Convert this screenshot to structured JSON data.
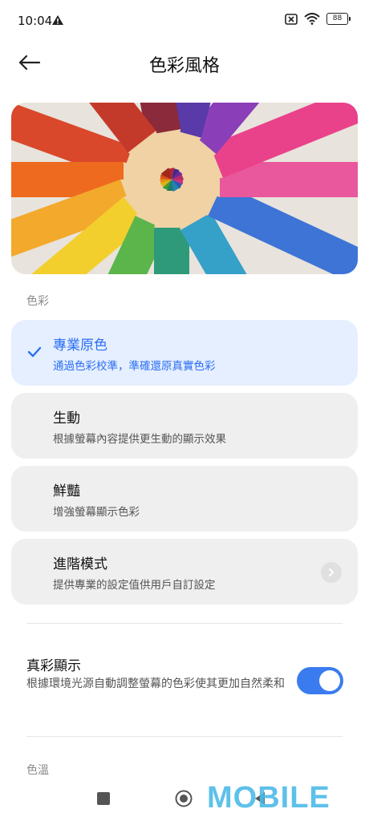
{
  "status_bar": {
    "time": "10:04",
    "battery": "88"
  },
  "header": {
    "title": "色彩風格"
  },
  "sections": {
    "color_label": "色彩",
    "temperature_label": "色溫"
  },
  "options": [
    {
      "title": "專業原色",
      "desc": "通過色彩校準，準確還原真實色彩",
      "selected": true
    },
    {
      "title": "生動",
      "desc": "根據螢幕內容提供更生動的顯示效果",
      "selected": false
    },
    {
      "title": "鮮豔",
      "desc": "增強螢幕顯示色彩",
      "selected": false
    },
    {
      "title": "進階模式",
      "desc": "提供專業的設定值供用戶自訂設定",
      "selected": false
    }
  ],
  "true_tone": {
    "title": "真彩顯示",
    "desc": "根據環境光源自動調整螢幕的色彩使其更加自然柔和",
    "enabled": true
  },
  "watermark": "MOBILE",
  "colors": {
    "accent": "#2a6ef5",
    "selected_bg": "#e6efff",
    "card_bg": "#efefef",
    "toggle_on": "#3a7cf0"
  }
}
